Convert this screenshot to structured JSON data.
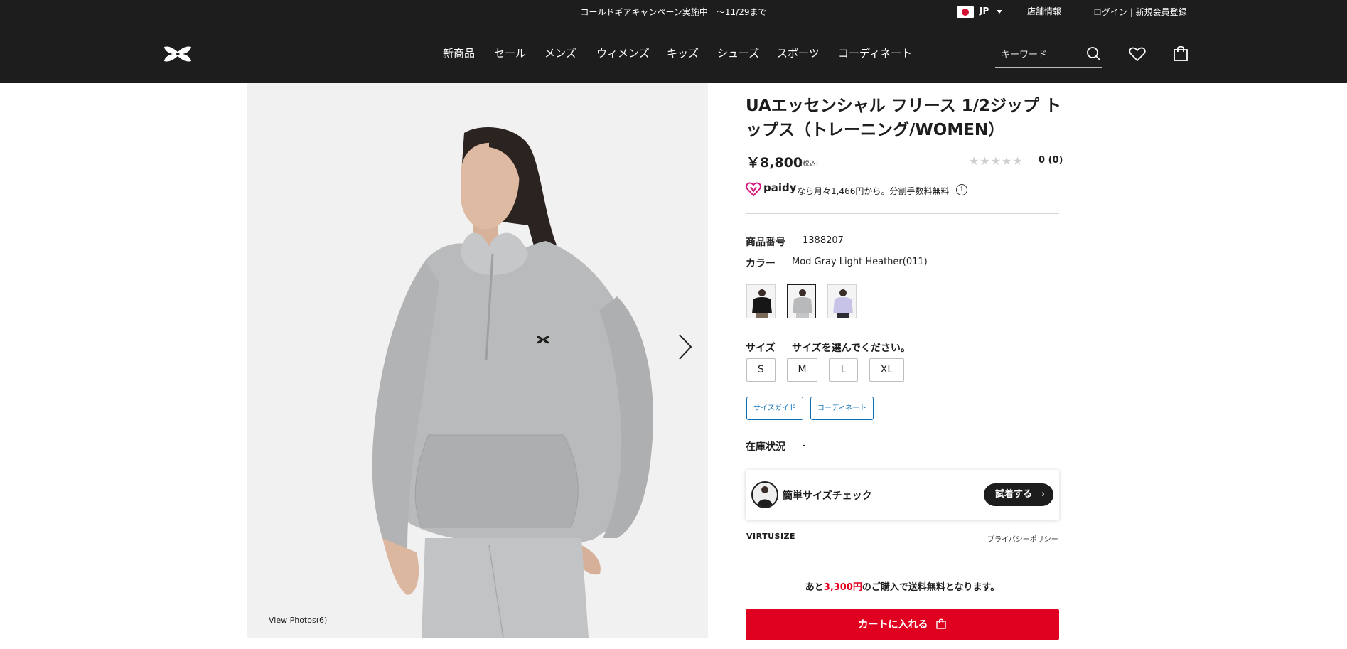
{
  "topbar": {
    "campaign": "コールドギアキャンペーン実施中　〜11/29まで",
    "region": "JP",
    "stores": "店舗情報",
    "login": "ログイン | 新規会員登録"
  },
  "nav": {
    "items": [
      "新商品",
      "セール",
      "メンズ",
      "ウィメンズ",
      "キッズ",
      "シューズ",
      "スポーツ",
      "コーディネート"
    ],
    "search_placeholder": "キーワード"
  },
  "gallery": {
    "view_photos": "View Photos(6)"
  },
  "product": {
    "title_line1": "UAエッセンシャル フリース 1/2ジップ ト",
    "title_line2": "ップス（トレーニング/WOMEN）",
    "price": "￥8,800",
    "tax_note": "(税込)",
    "stars": "★★★★★",
    "rating": "0 (0)",
    "paidy_brand": "paidy",
    "paidy_text": "なら月々1,466円から。分割手数料無料",
    "product_number_label": "商品番号",
    "product_number": "1388207",
    "color_label": "カラー",
    "color_value": "Mod Gray Light Heather(011)",
    "size_label": "サイズ",
    "size_prompt": "サイズを選んでください。",
    "sizes": [
      "S",
      "M",
      "L",
      "XL"
    ],
    "size_guide": "サイズガイド",
    "coordinate": "コーディネート",
    "stock_label": "在庫状況",
    "stock_value": "-"
  },
  "virtusize": {
    "title": "簡単サイズチェック",
    "try_button": "試着する",
    "logo": "VIRTUSIZE",
    "privacy": "プライバシーポリシー"
  },
  "shipping": {
    "prefix": "あと",
    "amount": "3,300円",
    "suffix": "のご購入で送料無料となります。"
  },
  "cart": {
    "add_label": "カートに入れる"
  },
  "colors": {
    "brand_dark": "#1d1d1d",
    "accent_red": "#e00020",
    "link_blue": "#0a6fb8"
  }
}
